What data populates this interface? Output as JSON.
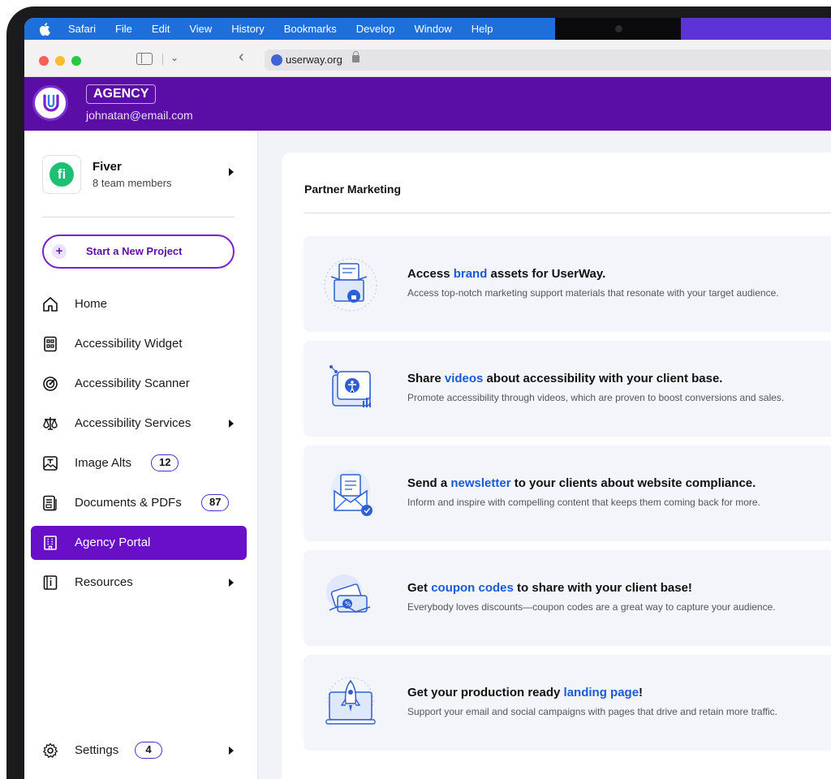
{
  "menubar": {
    "items": [
      "Safari",
      "File",
      "Edit",
      "View",
      "History",
      "Bookmarks",
      "Develop",
      "Window",
      "Help"
    ]
  },
  "toolbar": {
    "url": "userway.org"
  },
  "header": {
    "badge": "AGENCY",
    "email": "johnatan@email.com"
  },
  "team": {
    "logo_letter": "fi",
    "name": "Fiver",
    "members": "8 team members"
  },
  "sidebar": {
    "new_project": "Start a New Project",
    "items": [
      {
        "label": "Home",
        "icon": "home-icon"
      },
      {
        "label": "Accessibility Widget",
        "icon": "widget-icon"
      },
      {
        "label": "Accessibility Scanner",
        "icon": "scanner-icon"
      },
      {
        "label": "Accessibility Services",
        "icon": "services-icon"
      },
      {
        "label": "Image Alts",
        "icon": "image-icon",
        "badge": "12"
      },
      {
        "label": "Documents & PDFs",
        "icon": "document-icon",
        "badge": "87"
      },
      {
        "label": "Agency Portal",
        "icon": "building-icon",
        "active": true
      },
      {
        "label": "Resources",
        "icon": "book-icon"
      }
    ],
    "settings": {
      "label": "Settings",
      "badge": "4",
      "icon": "gear-icon"
    }
  },
  "main": {
    "section_title": "Partner Marketing",
    "cards": [
      {
        "pre": "Access ",
        "highlight": "brand",
        "post": " assets for UserWay.",
        "desc": "Access top-notch marketing support materials that resonate with your target audience.",
        "icon": "brand-assets-icon"
      },
      {
        "pre": "Share ",
        "highlight": "videos",
        "post": " about accessibility with your client base.",
        "desc": "Promote accessibility through videos, which are proven to boost conversions and sales.",
        "icon": "video-icon"
      },
      {
        "pre": "Send a ",
        "highlight": "newsletter",
        "post": " to your clients about website compliance.",
        "desc": "Inform and inspire with compelling content that keeps them coming back for more.",
        "icon": "newsletter-icon"
      },
      {
        "pre": "Get ",
        "highlight": "coupon codes",
        "post": " to share with your client base!",
        "desc": "Everybody loves discounts—coupon codes are a great way to capture your audience.",
        "icon": "coupon-icon"
      },
      {
        "pre": "Get your production ready ",
        "highlight": "landing page",
        "post": "!",
        "desc": "Support your email and social campaigns with pages that drive and retain more traffic.",
        "icon": "landing-page-icon"
      }
    ]
  },
  "colors": {
    "brand_purple": "#5b0ea6",
    "active_item": "#6a0fc8",
    "highlight_blue": "#1a5ad8",
    "menubar_blue": "#1e6fd9"
  }
}
